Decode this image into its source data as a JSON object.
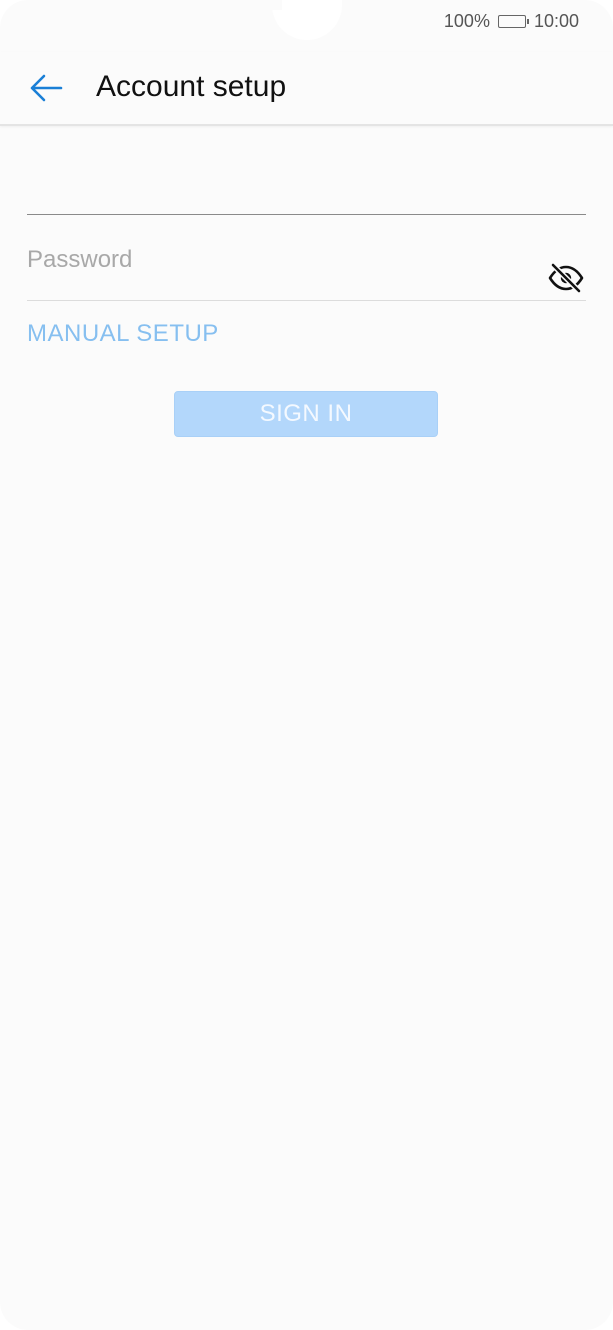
{
  "status_bar": {
    "battery_percent": "100%",
    "time": "10:00"
  },
  "app_bar": {
    "title": "Account setup"
  },
  "form": {
    "email_value": "",
    "password_placeholder": "Password",
    "manual_setup_label": "MANUAL SETUP",
    "sign_in_label": "SIGN IN"
  },
  "icons": {
    "back": "arrow-left-icon",
    "password_visibility": "eye-off-icon",
    "battery": "battery-icon"
  },
  "colors": {
    "accent": "#1a7fd6",
    "link": "#86bff0",
    "button_disabled": "#b3d7fb"
  }
}
